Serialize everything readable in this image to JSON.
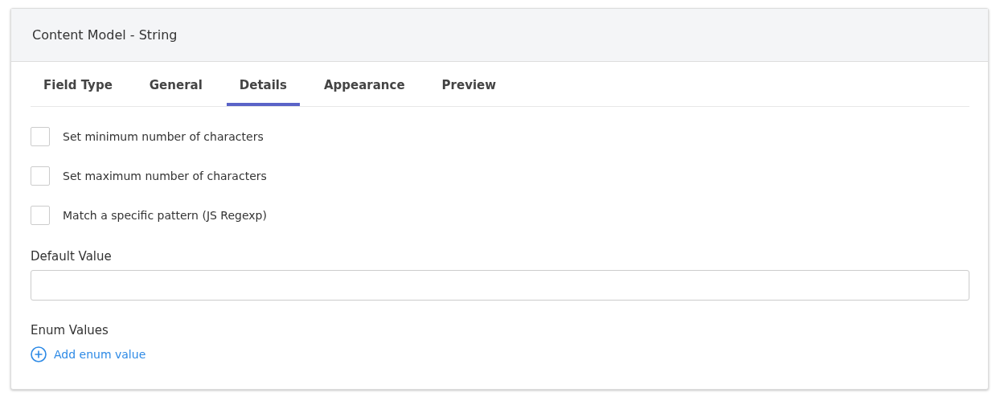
{
  "header": {
    "title": "Content Model - String"
  },
  "tabs": [
    {
      "label": "Field Type",
      "selected": false
    },
    {
      "label": "General",
      "selected": false
    },
    {
      "label": "Details",
      "selected": true
    },
    {
      "label": "Appearance",
      "selected": false
    },
    {
      "label": "Preview",
      "selected": false
    }
  ],
  "options": [
    {
      "label": "Set minimum number of characters",
      "checked": false
    },
    {
      "label": "Set maximum number of characters",
      "checked": false
    },
    {
      "label": "Match a specific pattern (JS Regexp)",
      "checked": false
    }
  ],
  "default_value": {
    "label": "Default Value"
  },
  "enum_values": {
    "label": "Enum Values",
    "add_link": "Add enum value"
  }
}
